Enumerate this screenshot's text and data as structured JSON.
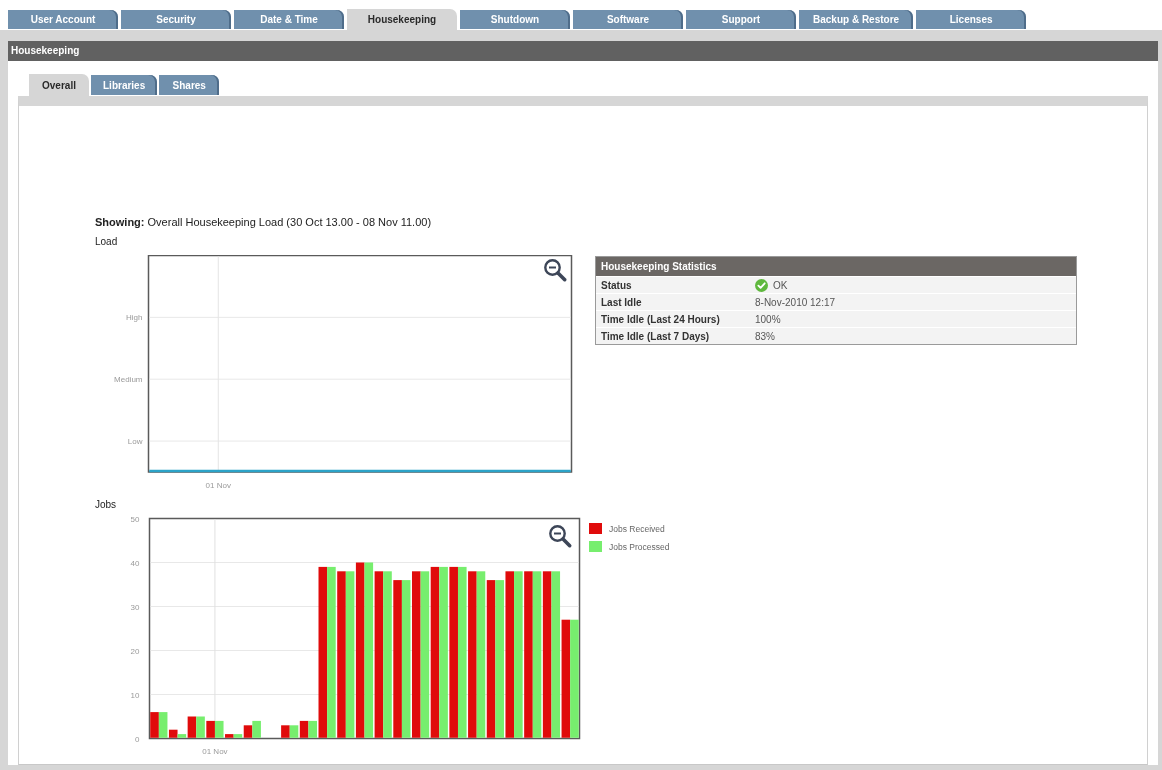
{
  "top_tabs": [
    {
      "label": "User Account",
      "selected": false
    },
    {
      "label": "Security",
      "selected": false
    },
    {
      "label": "Date & Time",
      "selected": false
    },
    {
      "label": "Housekeeping",
      "selected": true
    },
    {
      "label": "Shutdown",
      "selected": false
    },
    {
      "label": "Software",
      "selected": false
    },
    {
      "label": "Support",
      "selected": false
    },
    {
      "label": "Backup & Restore",
      "selected": false
    },
    {
      "label": "Licenses",
      "selected": false
    }
  ],
  "panel": {
    "title": "Housekeeping"
  },
  "sub_tabs": [
    {
      "label": "Overall",
      "selected": true
    },
    {
      "label": "Libraries",
      "selected": false
    },
    {
      "label": "Shares",
      "selected": false
    }
  ],
  "showing": "**Showing:** Overall Housekeeping Load (30 Oct 13.00 - 08 Nov 11.00)",
  "load_chart": {
    "title": "Load",
    "y_labels": [
      "High",
      "Medium",
      "Low"
    ],
    "x_labels": [
      "01 Nov"
    ]
  },
  "statistics": {
    "title": "Housekeeping Statistics",
    "rows": [
      {
        "kind": "status",
        "label": "Status",
        "value": "OK"
      },
      {
        "kind": "text",
        "label": "Last Idle",
        "value": "8-Nov-2010 12:17"
      },
      {
        "kind": "text",
        "label": "Time Idle (Last 24 Hours)",
        "value": "100%"
      },
      {
        "kind": "text",
        "label": "Time Idle (Last 7 Days)",
        "value": "83%"
      }
    ]
  },
  "jobs_chart": {
    "chart_data": [
      {
        "type": "bar",
        "ylabel": "Jobs",
        "categories": [
          null,
          null,
          null,
          "01 Nov",
          null,
          null,
          null,
          null,
          null,
          null,
          null,
          null,
          null,
          null,
          null,
          null,
          null,
          null,
          null,
          null,
          null,
          null,
          null
        ],
        "series": [
          {
            "name": "Jobs Received",
            "color": "#e00b0b",
            "values": [
              6,
              2,
              5,
              4,
              1,
              3,
              null,
              3,
              4,
              39,
              38,
              40,
              38,
              36,
              38,
              39,
              39,
              38,
              36,
              38,
              38,
              38,
              27
            ]
          },
          {
            "name": "Jobs Processed",
            "color": "#77ee6e",
            "values": [
              6,
              1,
              5,
              4,
              1,
              4,
              null,
              3,
              4,
              39,
              38,
              40,
              38,
              36,
              38,
              39,
              39,
              38,
              36,
              38,
              38,
              38,
              27
            ]
          }
        ],
        "ylim": [
          0,
          50
        ],
        "yticks": [
          0,
          10,
          20,
          30,
          40,
          50
        ],
        "grid": true,
        "legend": "right"
      }
    ]
  }
}
